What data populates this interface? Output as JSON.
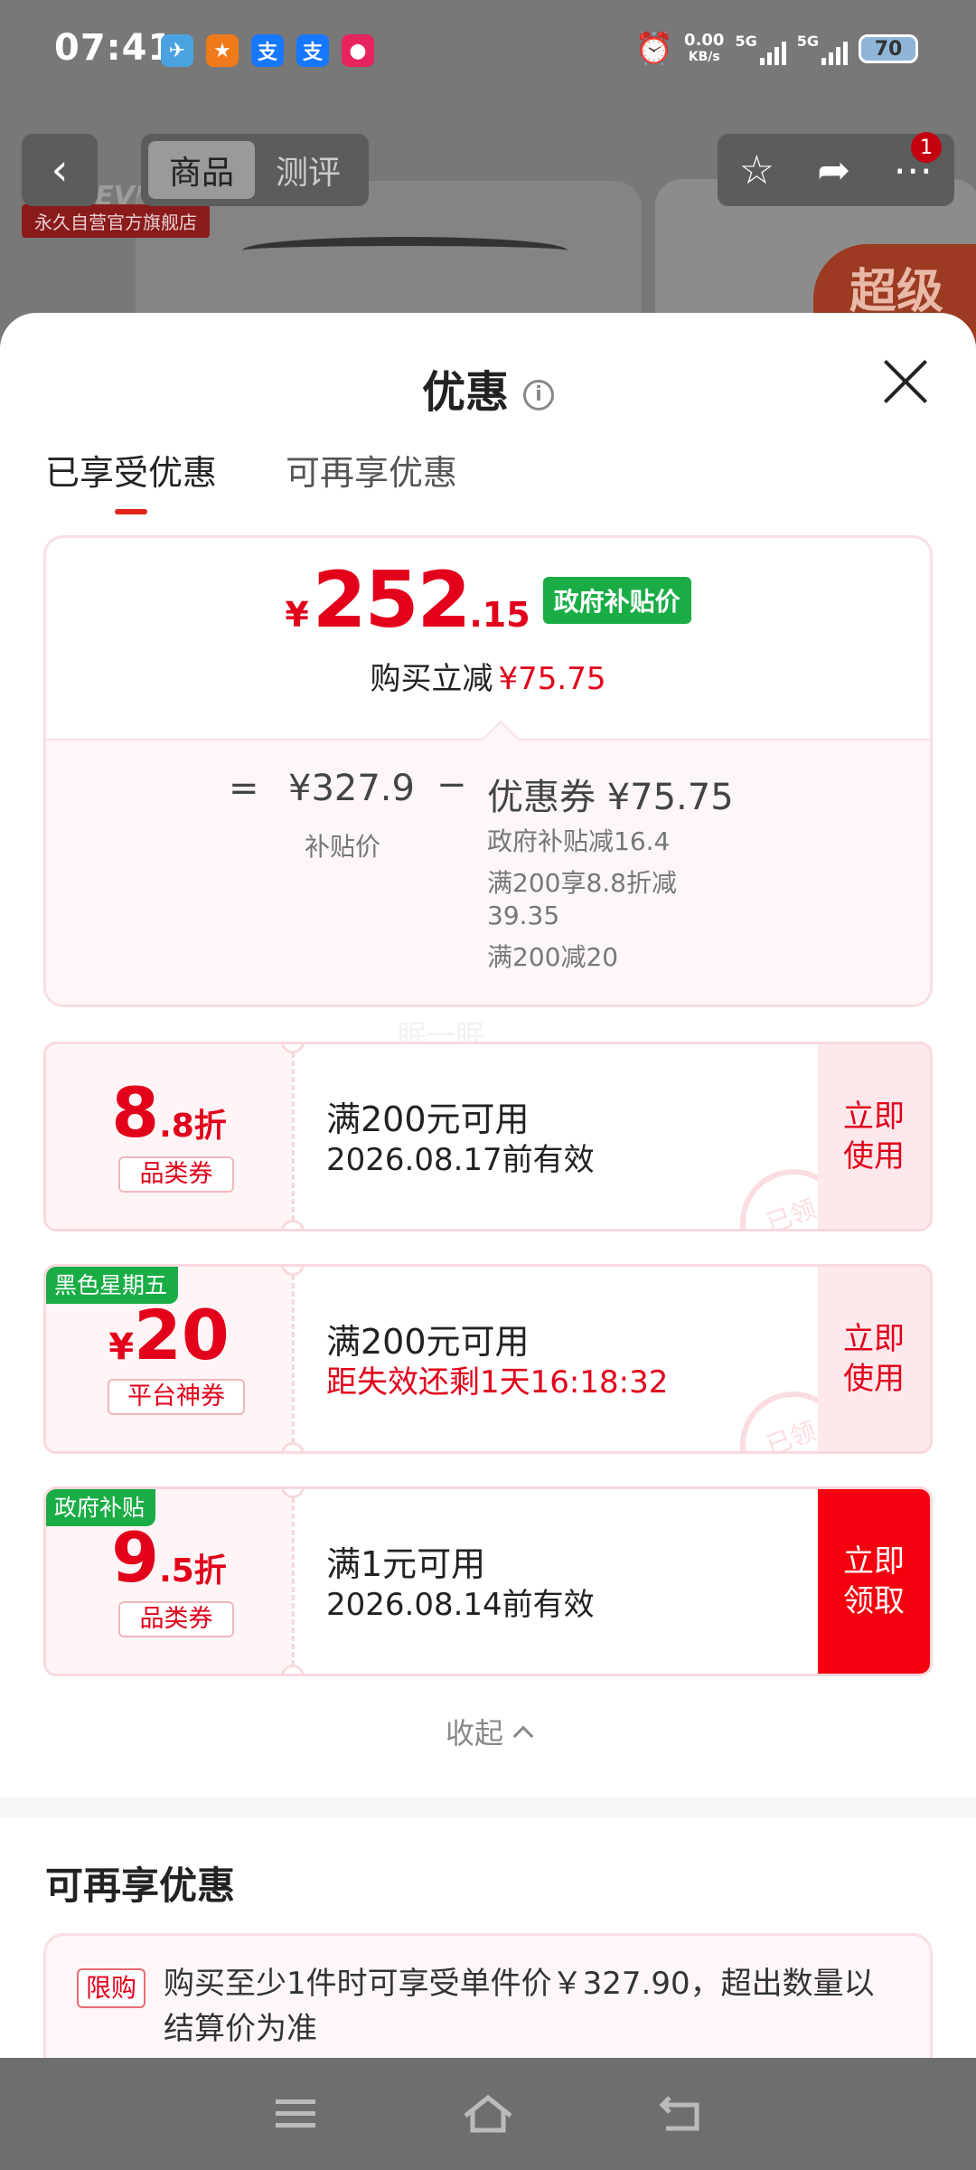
{
  "status_bar": {
    "time": "07:41",
    "net_speed_value": "0.00",
    "net_speed_unit": "KB/s",
    "sim1": "5G",
    "sim2": "5G",
    "battery": "70"
  },
  "background": {
    "tabs": [
      "商品",
      "测评"
    ],
    "active_tab": "商品",
    "cart_badge": "1",
    "brand_logo": "FOREVER",
    "store_tag": "永久自营官方旗舰店",
    "promo_tag": "超级"
  },
  "sheet": {
    "title": "优惠",
    "tabs": [
      "已享受优惠",
      "可再享优惠"
    ],
    "active_tab_index": 0
  },
  "price_card": {
    "yen": "¥",
    "price_int": "252",
    "price_dec": ".15",
    "badge": "政府补贴价",
    "instant_label": "购买立减",
    "instant_value": "¥75.75",
    "eq": "=",
    "base_price": "¥327.9",
    "minus": "−",
    "coupon_label": "优惠券 ¥75.75",
    "base_label": "补贴价",
    "details": [
      "政府补贴减16.4",
      "满200享8.8折减39.35",
      "满200减20"
    ]
  },
  "watermark": "眠一眠",
  "coupons": [
    {
      "amount_big": "8",
      "amount_small": ".8折",
      "type": "品类券",
      "tag": "",
      "condition": "满200元可用",
      "sub": "2026.08.17前有效",
      "action": "立即使用",
      "stamp": "已领"
    },
    {
      "amount_yen": "¥",
      "amount_big": "20",
      "type": "平台神券",
      "tag": "黑色星期五",
      "condition": "满200元可用",
      "sub": "距失效还剩1天16:18:32",
      "action": "立即使用",
      "stamp": "已领"
    },
    {
      "amount_big": "9",
      "amount_small": ".5折",
      "type": "品类券",
      "tag": "政府补贴",
      "condition": "满1元可用",
      "sub": "2026.08.14前有效",
      "action": "立即领取"
    }
  ],
  "collapse_label": "收起",
  "more_section": {
    "title": "可再享优惠",
    "limit_badge": "限购",
    "limit_text": "购买至少1件时可享受单件价￥327.90，超出数量以结算价为准"
  },
  "colors": {
    "accent_red": "#e2001a",
    "subsidy_green": "#1aad46",
    "coupon_bg": "#fff5f6"
  }
}
